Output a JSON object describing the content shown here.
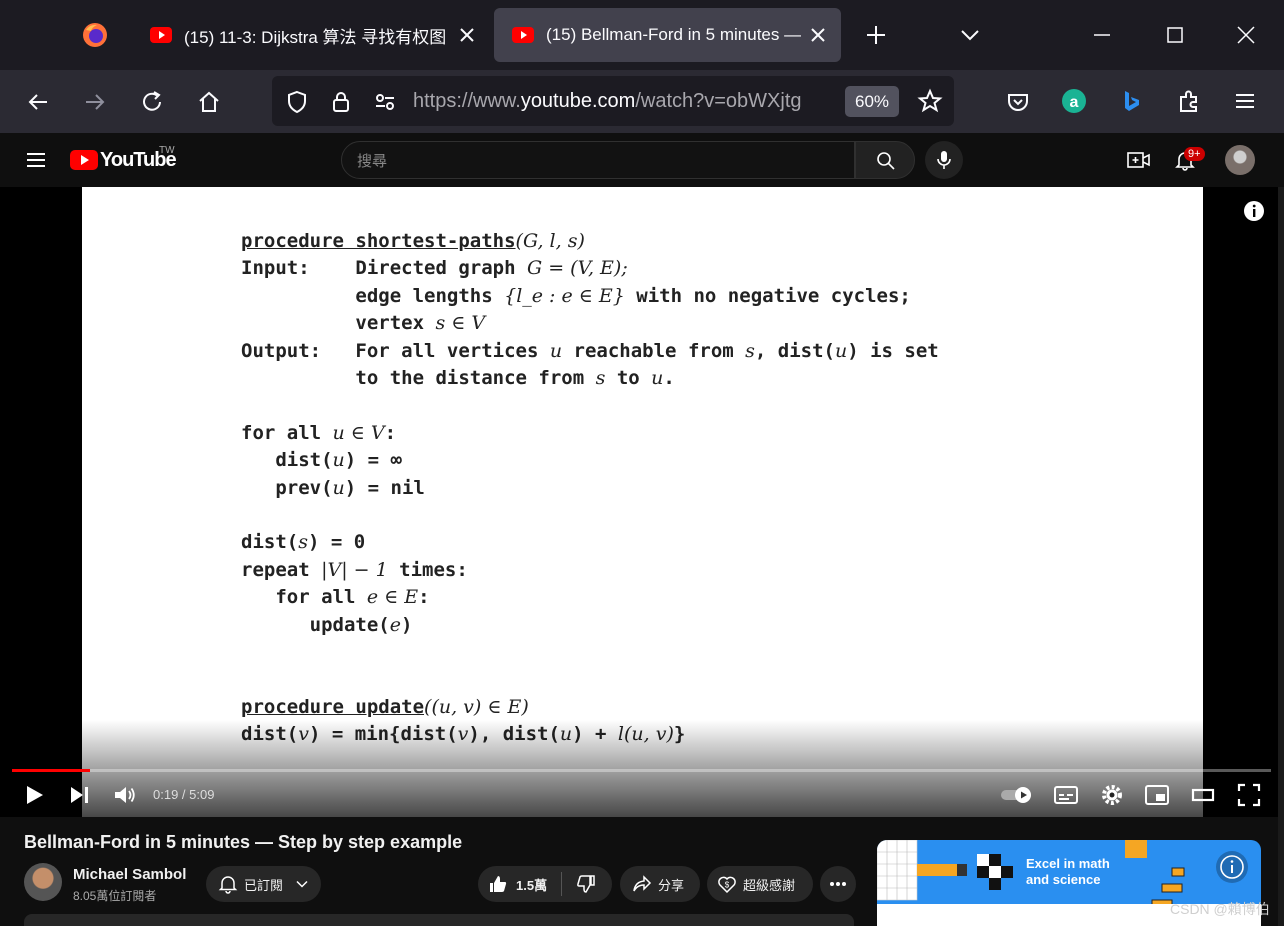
{
  "browser": {
    "tabs": [
      {
        "title": "(15) 11-3: Dijkstra 算法 寻找有权图",
        "active": false
      },
      {
        "title": "(15) Bellman-Ford in 5 minutes —",
        "active": true
      }
    ],
    "url_prefix": "https://www.",
    "url_domain": "youtube.com",
    "url_path": "/watch?v=obWXjtg",
    "zoom": "60%"
  },
  "youtube": {
    "logo_text": "YouTube",
    "region": "TW",
    "search_placeholder": "搜尋",
    "notification_count": "9+"
  },
  "slide": {
    "lines": [
      [
        "procedure shortest-paths",
        "(G, l, s)"
      ],
      [
        "Input:    Directed graph ",
        "G = (V, E);"
      ],
      [
        "          edge lengths ",
        "{l_e : e ∈ E}",
        " with no negative cycles;"
      ],
      [
        "          vertex ",
        "s ∈ V"
      ],
      [
        "Output:   For all vertices ",
        "u",
        " reachable from ",
        "s",
        ", dist(",
        "u",
        ") is set"
      ],
      [
        "          to the distance from ",
        "s",
        " to ",
        "u",
        "."
      ],
      [
        ""
      ],
      [
        "for all ",
        "u ∈ V",
        ":"
      ],
      [
        "   dist(",
        "u",
        ") = ∞"
      ],
      [
        "   prev(",
        "u",
        ") = nil"
      ],
      [
        ""
      ],
      [
        "dist(",
        "s",
        ") = 0"
      ],
      [
        "repeat ",
        "|V| − 1",
        " times:"
      ],
      [
        "   for all ",
        "e ∈ E",
        ":"
      ],
      [
        "      update(",
        "e",
        ")"
      ],
      [
        ""
      ],
      [
        ""
      ],
      [
        "procedure update",
        "((u, v) ∈ E)"
      ],
      [
        "dist(",
        "v",
        ") = min{dist(",
        "v",
        "), dist(",
        "u",
        ") + ",
        "l(u, v)",
        "}"
      ]
    ]
  },
  "player": {
    "current_time": "0:19",
    "duration": "5:09",
    "progress_fraction": 0.062
  },
  "video": {
    "title": "Bellman-Ford in 5 minutes — Step by step example",
    "channel": "Michael Sambol",
    "subscribers": "8.05萬位訂閱者",
    "subscribe_label": "已訂閱",
    "likes": "1.5萬",
    "share_label": "分享",
    "thanks_label": "超級感謝"
  },
  "ad": {
    "line1": "Excel in math",
    "line2": "and science"
  },
  "watermark": "CSDN @賴博伯",
  "colors": {
    "youtube_red": "#ff0000",
    "tab_active": "#42414d",
    "toolbar": "#2b2a33",
    "ad_blue": "#2a8ff0"
  }
}
